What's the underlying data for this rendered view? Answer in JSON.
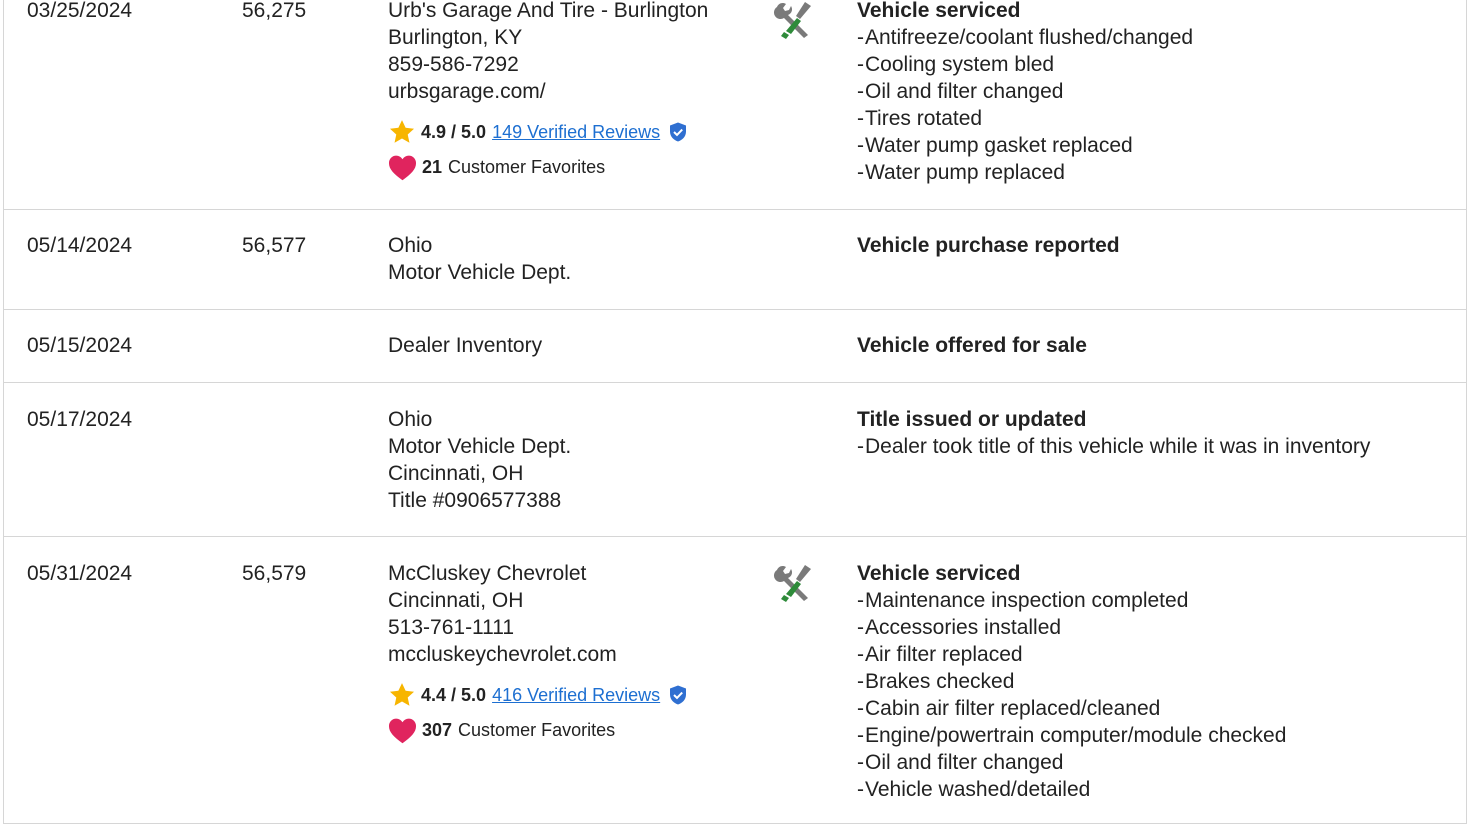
{
  "history": {
    "records": [
      {
        "date": "03/25/2024",
        "odometer": "56,275",
        "source": [
          "Urb's Garage And Tire - Burlington",
          "Burlington, KY",
          "859-586-7292",
          "urbsgarage.com/"
        ],
        "rating": {
          "score": "4.9 / 5.0",
          "reviews": "149 Verified Reviews"
        },
        "favorites": {
          "count": "21",
          "label": "Customer Favorites"
        },
        "icon": "service-wrench-icon",
        "heading": "Vehicle serviced",
        "details": [
          "Antifreeze/coolant flushed/changed",
          "Cooling system bled",
          "Oil and filter changed",
          "Tires rotated",
          "Water pump gasket replaced",
          "Water pump replaced"
        ]
      },
      {
        "date": "05/14/2024",
        "odometer": "56,577",
        "source": [
          "Ohio",
          "Motor Vehicle Dept."
        ],
        "heading": "Vehicle purchase reported",
        "details": []
      },
      {
        "date": "05/15/2024",
        "odometer": "",
        "source": [
          "Dealer Inventory"
        ],
        "heading": "Vehicle offered for sale",
        "details": []
      },
      {
        "date": "05/17/2024",
        "odometer": "",
        "source": [
          "Ohio",
          "Motor Vehicle Dept.",
          "Cincinnati, OH",
          "Title #0906577388"
        ],
        "heading": "Title issued or updated",
        "details": [
          "Dealer took title of this vehicle while it was in inventory"
        ]
      },
      {
        "date": "05/31/2024",
        "odometer": "56,579",
        "source": [
          "McCluskey Chevrolet",
          "Cincinnati, OH",
          "513-761-1111",
          "mccluskeychevrolet.com"
        ],
        "rating": {
          "score": "4.4 / 5.0",
          "reviews": "416 Verified Reviews"
        },
        "favorites": {
          "count": "307",
          "label": "Customer Favorites"
        },
        "icon": "service-wrench-icon",
        "heading": "Vehicle serviced",
        "details": [
          "Maintenance inspection completed",
          "Accessories installed",
          "Air filter replaced",
          "Brakes checked",
          "Cabin air filter replaced/cleaned",
          "Engine/powertrain computer/module checked",
          "Oil and filter changed",
          "Vehicle washed/detailed"
        ]
      }
    ]
  },
  "colors": {
    "star": "#f7b500",
    "heart": "#e0245e",
    "link": "#1d6fd1",
    "badge": "#2f6fd1",
    "wrench_gray": "#7a7a7a",
    "screwdriver_green": "#2e8b3a"
  }
}
